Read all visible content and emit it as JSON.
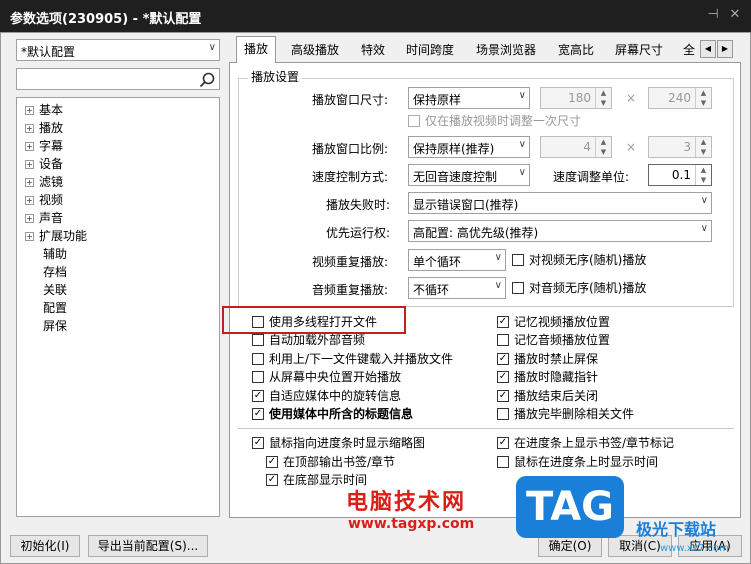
{
  "window": {
    "title": "参数选项(230905) - *默认配置",
    "pin_glyph": "⊣",
    "close_glyph": "✕"
  },
  "profile": {
    "selected": "*默认配置"
  },
  "search": {
    "value": ""
  },
  "tree": {
    "items": [
      {
        "label": "基本",
        "expandable": true
      },
      {
        "label": "播放",
        "expandable": true
      },
      {
        "label": "字幕",
        "expandable": true
      },
      {
        "label": "设备",
        "expandable": true
      },
      {
        "label": "滤镜",
        "expandable": true
      },
      {
        "label": "视频",
        "expandable": true
      },
      {
        "label": "声音",
        "expandable": true
      },
      {
        "label": "扩展功能",
        "expandable": true
      },
      {
        "label": "辅助",
        "expandable": false
      },
      {
        "label": "存档",
        "expandable": false
      },
      {
        "label": "关联",
        "expandable": false
      },
      {
        "label": "配置",
        "expandable": false
      },
      {
        "label": "屏保",
        "expandable": false
      }
    ]
  },
  "tabs": [
    "播放",
    "高级播放",
    "特效",
    "时间跨度",
    "场景浏览器",
    "宽高比",
    "屏幕尺寸",
    "全"
  ],
  "active_tab": "播放",
  "group_title": "播放设置",
  "settings": {
    "window_size_label": "播放窗口尺寸:",
    "window_size_value": "保持原样",
    "width": "180",
    "height": "240",
    "times": "×",
    "only_once": "仅在播放视频时调整一次尺寸",
    "ratio_label": "播放窗口比例:",
    "ratio_value": "保持原样(推荐)",
    "ratio_w": "4",
    "ratio_h": "3",
    "speed_label": "速度控制方式:",
    "speed_value": "无回音速度控制",
    "speed_unit_label": "速度调整单位:",
    "speed_unit_value": "0.1",
    "fail_label": "播放失败时:",
    "fail_value": "显示错误窗口(推荐)",
    "priority_label": "优先运行权:",
    "priority_value": "高配置: 高优先级(推荐)",
    "video_repeat_label": "视频重复播放:",
    "video_repeat_value": "单个循环",
    "video_shuffle": "对视频无序(随机)播放",
    "audio_repeat_label": "音频重复播放:",
    "audio_repeat_value": "不循环",
    "audio_shuffle": "对音频无序(随机)播放"
  },
  "left_checks": [
    {
      "label": "使用多线程打开文件",
      "checked": false,
      "bold": false
    },
    {
      "label": "自动加载外部音频",
      "checked": false,
      "bold": false
    },
    {
      "label": "利用上/下一文件键载入并播放文件",
      "checked": false,
      "bold": false
    },
    {
      "label": "从屏幕中央位置开始播放",
      "checked": false,
      "bold": false
    },
    {
      "label": "自适应媒体中的旋转信息",
      "checked": true,
      "bold": false
    },
    {
      "label": "使用媒体中所含的标题信息",
      "checked": true,
      "bold": true
    }
  ],
  "right_checks": [
    {
      "label": "记忆视频播放位置",
      "checked": true
    },
    {
      "label": "记忆音频播放位置",
      "checked": false
    },
    {
      "label": "播放时禁止屏保",
      "checked": true
    },
    {
      "label": "播放时隐藏指针",
      "checked": true
    },
    {
      "label": "播放结束后关闭",
      "checked": true
    },
    {
      "label": "播放完毕删除相关文件",
      "checked": false
    }
  ],
  "bottom_checks_left": [
    {
      "label": "鼠标指向进度条时显示缩略图",
      "checked": true
    },
    {
      "label": "在顶部输出书签/章节",
      "checked": true
    },
    {
      "label": "在底部显示时间",
      "checked": true
    }
  ],
  "bottom_checks_right": [
    {
      "label": "在进度条上显示书签/章节标记",
      "checked": true
    },
    {
      "label": "鼠标在进度条上时显示时间",
      "checked": false
    }
  ],
  "buttons": {
    "init": "初始化(I)",
    "export": "导出当前配置(S)...",
    "ok": "确定(O)",
    "cancel": "取消(C)",
    "apply": "应用(A)"
  },
  "watermark": {
    "site_name": "电脑技术网",
    "url": "www.tagxp.com",
    "logo": "TAG",
    "brand": "极光下载站",
    "brand_url": "www.xz7.com"
  },
  "colors": {
    "highlight_box": "#c0201e",
    "watermark_red": "#d8201a",
    "logo_blue": "#1a7fd8"
  }
}
